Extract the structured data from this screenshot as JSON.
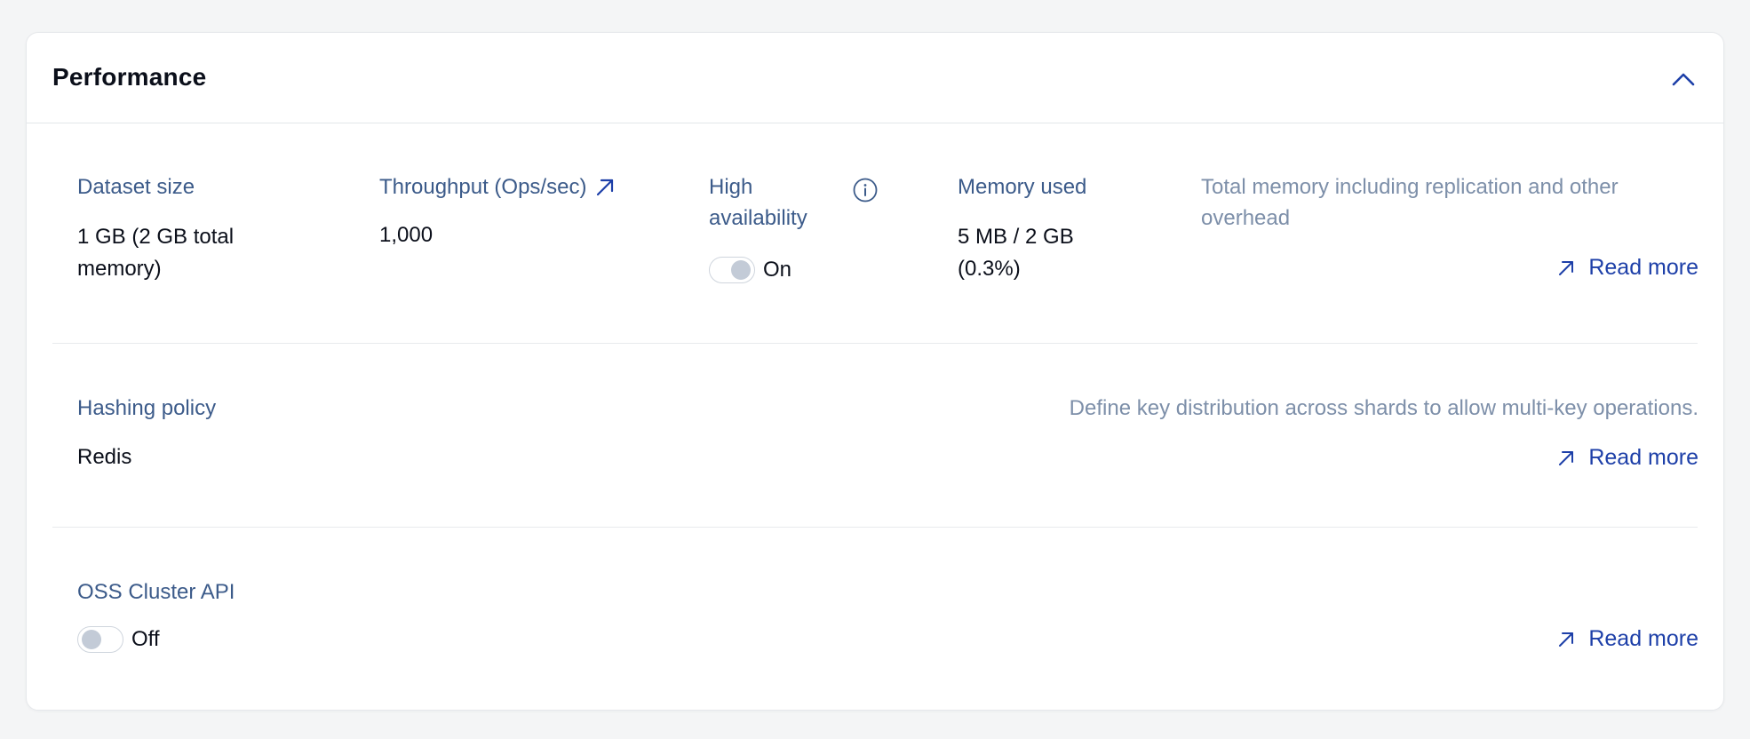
{
  "panel": {
    "title": "Performance",
    "collapse_icon": "chevron-up-icon"
  },
  "colors": {
    "label": "#3c5b8a",
    "value": "#0b0f1a",
    "description": "#7d8fa9",
    "link": "#1d3fa8",
    "toggle_knob": "#c3cbd7"
  },
  "metrics": {
    "dataset_size": {
      "label": "Dataset size",
      "value_line1": "1 GB (2 GB total",
      "value_line2": "memory)"
    },
    "throughput": {
      "label": "Throughput (Ops/sec)",
      "value": "1,000",
      "icon": "external-arrow-icon"
    },
    "high_availability": {
      "label_line1": "High",
      "label_line2": "availability",
      "toggle_state": "On",
      "icon": "info-icon"
    },
    "memory_used": {
      "label": "Memory used",
      "value_line1": "5 MB / 2 GB",
      "value_line2": "(0.3%)"
    },
    "memory_description": {
      "line1": "Total memory including replication and other",
      "line2": "overhead",
      "link_label": "Read more"
    }
  },
  "hashing": {
    "label": "Hashing policy",
    "value": "Redis",
    "description": "Define key distribution across shards to allow multi-key operations.",
    "link_label": "Read more"
  },
  "oss_cluster": {
    "label": "OSS Cluster API",
    "toggle_state": "Off",
    "link_label": "Read more"
  }
}
